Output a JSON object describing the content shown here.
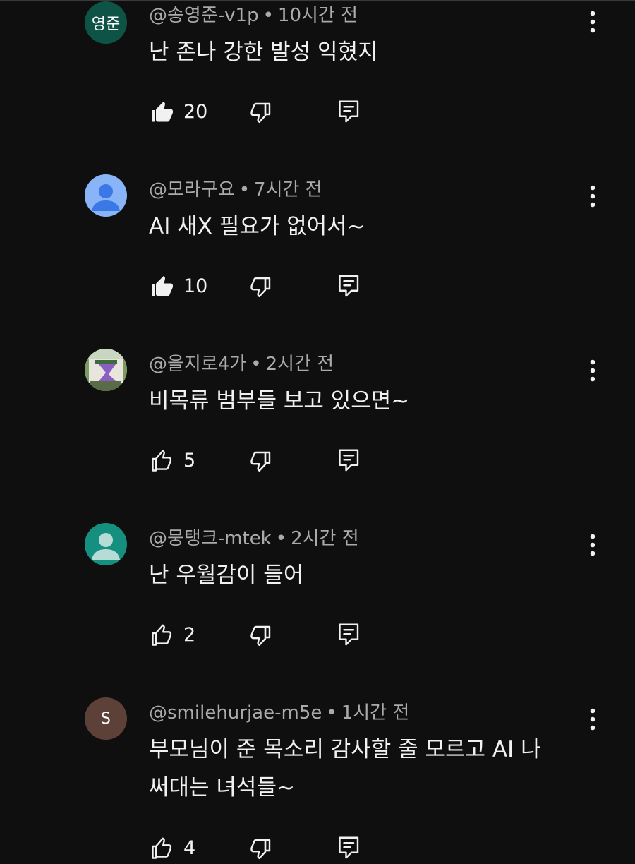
{
  "colors": {
    "background": "#0f0f0f",
    "text_primary": "#f1f1f1",
    "text_secondary": "#aaaaaa"
  },
  "comments": [
    {
      "handle": "@송영준-v1p",
      "separator": "•",
      "time": "10시간 전",
      "text": "난 존나 강한 발성 익혔지",
      "likes": "20",
      "liked": true,
      "avatar": {
        "type": "initials",
        "initials": "영준",
        "color": "#0d5446"
      }
    },
    {
      "handle": "@모라구요",
      "separator": "•",
      "time": "7시간 전",
      "text": "AI 새X 필요가 없어서~",
      "likes": "10",
      "liked": true,
      "avatar": {
        "type": "default-person",
        "color": "#8ab4f8"
      }
    },
    {
      "handle": "@을지로4가",
      "separator": "•",
      "time": "2시간 전",
      "text": "비목류 범부들 보고 있으면~",
      "likes": "5",
      "liked": false,
      "avatar": {
        "type": "photo",
        "color": "#7a8f5e",
        "photo_sign_text": "을지로4가"
      }
    },
    {
      "handle": "@뭉탱크-mtek",
      "separator": "•",
      "time": "2시간 전",
      "text": "난 우월감이 들어",
      "likes": "2",
      "liked": false,
      "avatar": {
        "type": "default-person",
        "color": "#159080"
      }
    },
    {
      "handle": "@smilehurjae-m5e",
      "separator": "•",
      "time": "1시간 전",
      "text": "부모님이 준 목소리 감사할 줄 모르고 AI 나 써대는 녀석들~",
      "likes": "4",
      "liked": false,
      "avatar": {
        "type": "initials",
        "initials": "S",
        "color": "#5d4037"
      }
    }
  ],
  "icons": {
    "like": "thumb-up-icon",
    "dislike": "thumb-down-icon",
    "reply": "comment-reply-icon",
    "more": "more-vertical-icon"
  }
}
